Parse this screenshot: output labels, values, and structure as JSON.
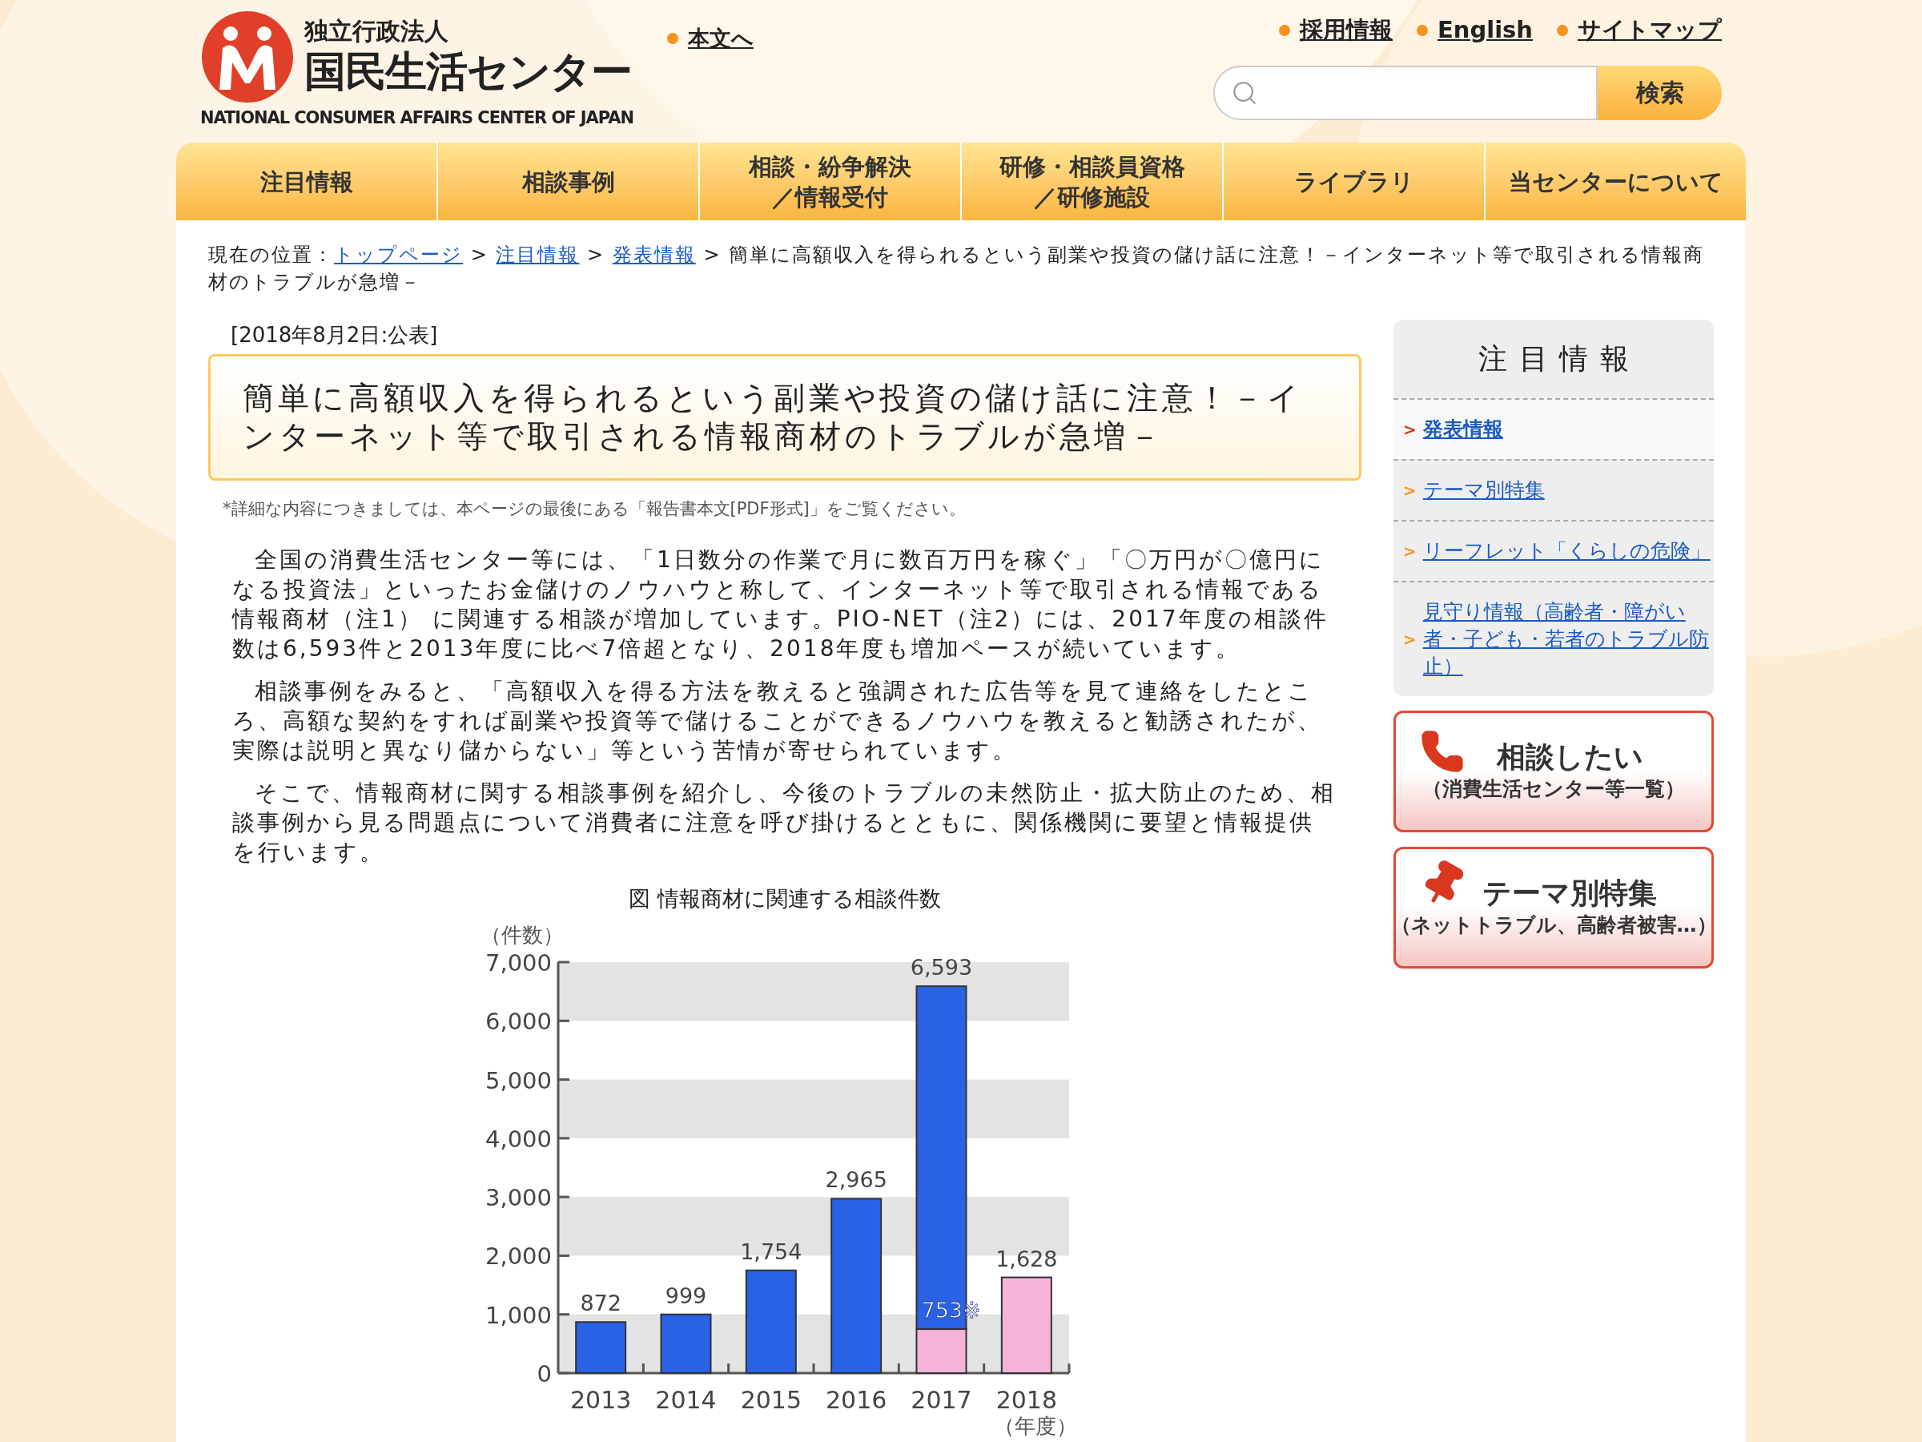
{
  "header": {
    "logo": {
      "org_type": "独立行政法人",
      "name": "国民生活センター",
      "english_name": "NATIONAL CONSUMER AFFAIRS CENTER OF JAPAN"
    },
    "skip_link": "本文へ",
    "utility_links": [
      "採用情報",
      "English",
      "サイトマップ"
    ],
    "search": {
      "button": "検索"
    }
  },
  "nav": [
    {
      "lines": [
        "注目情報"
      ]
    },
    {
      "lines": [
        "相談事例"
      ]
    },
    {
      "lines": [
        "相談・紛争解決",
        "／情報受付"
      ]
    },
    {
      "lines": [
        "研修・相談員資格",
        "／研修施設"
      ]
    },
    {
      "lines": [
        "ライブラリ"
      ]
    },
    {
      "lines": [
        "当センターについて"
      ]
    }
  ],
  "breadcrumb": {
    "label": "現在の位置：",
    "items": [
      {
        "kind": "link",
        "text": "トップページ"
      },
      {
        "kind": "separator",
        "text": ">"
      },
      {
        "kind": "link",
        "text": "注目情報"
      },
      {
        "kind": "separator",
        "text": ">"
      },
      {
        "kind": "link",
        "text": "発表情報"
      },
      {
        "kind": "separator",
        "text": ">"
      },
      {
        "kind": "current",
        "text": "簡単に高額収入を得られるという副業や投資の儲け話に注意！－インターネット等で取引される情報商材のトラブルが急増－"
      }
    ]
  },
  "article": {
    "date": "[2018年8月2日:公表]",
    "title": "簡単に高額収入を得られるという副業や投資の儲け話に注意！－インターネット等で取引される情報商材のトラブルが急増－",
    "note": "*詳細な内容につきましては、本ページの最後にある「報告書本文[PDF形式]」をご覧ください。",
    "paragraphs": [
      "全国の消費生活センター等には、「1日数分の作業で月に数百万円を稼ぐ」「〇万円が〇億円になる投資法」といったお金儲けのノウハウと称して、インターネット等で取引される情報である情報商材（注1） に関連する相談が増加しています。PIO-NET（注2）には、2017年度の相談件数は6,593件と2013年度に比べ7倍超となり、2018年度も増加ペースが続いています。",
      "相談事例をみると、「高額収入を得る方法を教えると強調された広告等を見て連絡をしたところ、高額な契約をすれば副業や投資等で儲けることができるノウハウを教えると勧誘されたが、実際は説明と異なり儲からない」等という苦情が寄せられています。",
      "そこで、情報商材に関する相談事例を紹介し、今後のトラブルの未然防止・拡大防止のため、相談事例から見る問題点について消費者に注意を呼び掛けるとともに、関係機関に要望と情報提供を行います。"
    ],
    "figure": {
      "caption": "図 情報商材に関連する相談件数",
      "chart_data": {
        "type": "bar",
        "stacked": true,
        "ylabel": "（件数）",
        "xlabel": "（年度）",
        "categories": [
          "2013",
          "2014",
          "2015",
          "2016",
          "2017",
          "2018"
        ],
        "series": [
          {
            "color": "#f7b2da",
            "values": [
              null,
              null,
              null,
              null,
              750,
              1630
            ]
          },
          {
            "color": "#2962e6",
            "values": [
              870,
              1000,
              1750,
              2970,
              5840,
              null
            ]
          }
        ],
        "ylim": [
          0,
          7000
        ],
        "yticks": [
          {
            "value": 0,
            "label": "0"
          },
          {
            "value": 1000,
            "label": "1,000"
          },
          {
            "value": 2000,
            "label": "2,000"
          },
          {
            "value": 3000,
            "label": "3,000"
          },
          {
            "value": 4000,
            "label": "4,000"
          },
          {
            "value": 5000,
            "label": "5,000"
          },
          {
            "value": 6000,
            "label": "6,000"
          },
          {
            "value": 7000,
            "label": "7,000"
          }
        ],
        "value_labels": [
          "872",
          "999",
          "1,754",
          "2,965",
          "6,593",
          "1,628"
        ],
        "annotations": [
          {
            "text": "753※"
          }
        ]
      }
    }
  },
  "sidebar": {
    "heading": "注目情報",
    "items": [
      {
        "marker": ">",
        "label": "発表情報",
        "selected": true
      },
      {
        "marker": ">",
        "label": "テーマ別特集",
        "selected": false
      },
      {
        "marker": ">",
        "label": "リーフレット「くらしの危険」",
        "selected": false
      },
      {
        "marker": ">",
        "label": "見守り情報（高齢者・障がい者・子ども・若者のトラブル防止）",
        "selected": false
      }
    ],
    "banners": [
      {
        "kind": "phone",
        "title": "相談したい",
        "subtitle": "（消費生活センター等一覧）"
      },
      {
        "kind": "pin",
        "title": "テーマ別特集",
        "subtitle": "（ネットトラブル、高齢者被害…）"
      }
    ]
  }
}
